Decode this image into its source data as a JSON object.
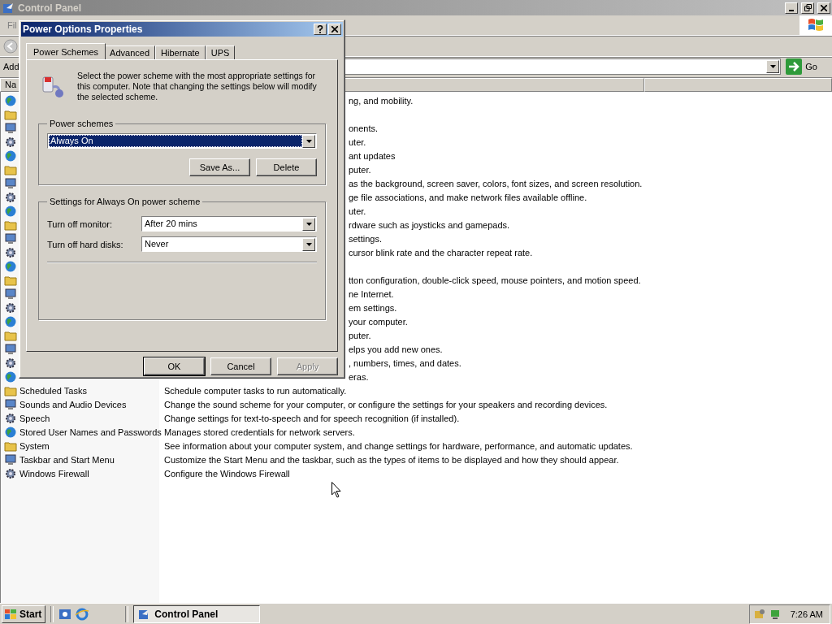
{
  "window": {
    "title": "Control Panel",
    "menu": [
      "Fil"
    ],
    "address_label": "Add",
    "go_button": "Go",
    "columns": [
      "Na"
    ]
  },
  "items": [
    {
      "kind": "partial",
      "description": "ng, and mobility."
    },
    {
      "kind": "blank"
    },
    {
      "kind": "partial",
      "description": "onents."
    },
    {
      "kind": "partial",
      "description": "uter."
    },
    {
      "kind": "partial",
      "description": "ant updates"
    },
    {
      "kind": "partial",
      "description": "puter."
    },
    {
      "kind": "partial",
      "description": "as the background, screen saver, colors, font sizes, and screen resolution."
    },
    {
      "kind": "partial",
      "description": "ge file associations, and make network files available offline."
    },
    {
      "kind": "partial",
      "description": "uter."
    },
    {
      "kind": "partial",
      "description": "rdware such as joysticks and gamepads."
    },
    {
      "kind": "partial",
      "description": "settings."
    },
    {
      "kind": "partial",
      "description": "cursor blink rate and the character repeat rate."
    },
    {
      "kind": "blank"
    },
    {
      "kind": "partial",
      "description": "tton configuration, double-click speed, mouse pointers, and motion speed."
    },
    {
      "kind": "partial",
      "description": "ne Internet."
    },
    {
      "kind": "partial",
      "description": "em settings."
    },
    {
      "kind": "partial",
      "description": "your computer."
    },
    {
      "kind": "partial",
      "description": "puter."
    },
    {
      "kind": "partial",
      "description": "elps you add new ones."
    },
    {
      "kind": "partial",
      "description": ", numbers, times, and dates."
    },
    {
      "kind": "partial",
      "description": "eras."
    },
    {
      "kind": "full",
      "name": "Scheduled Tasks",
      "description": "Schedule computer tasks to run automatically."
    },
    {
      "kind": "full",
      "name": "Sounds and Audio Devices",
      "description": "Change the sound scheme for your computer, or configure the settings for your speakers and recording devices."
    },
    {
      "kind": "full",
      "name": "Speech",
      "description": "Change settings for text-to-speech and for speech recognition (if installed)."
    },
    {
      "kind": "full",
      "name": "Stored User Names and Passwords",
      "description": "Manages stored credentials for network servers."
    },
    {
      "kind": "full",
      "name": "System",
      "description": "See information about your computer system, and change settings for hardware, performance, and automatic updates."
    },
    {
      "kind": "full",
      "name": "Taskbar and Start Menu",
      "description": "Customize the Start Menu and the taskbar, such as the types of items to be displayed and how they should appear."
    },
    {
      "kind": "full",
      "name": "Windows Firewall",
      "description": "Configure the Windows Firewall"
    }
  ],
  "dialog": {
    "title": "Power Options Properties",
    "tabs": [
      {
        "label": "Power Schemes",
        "selected": true
      },
      {
        "label": "Advanced",
        "selected": false
      },
      {
        "label": "Hibernate",
        "selected": false
      },
      {
        "label": "UPS",
        "selected": false
      }
    ],
    "intro": "Select the power scheme with the most appropriate settings for this computer. Note that changing the settings below will modify the selected scheme.",
    "schemes": {
      "label": "Power schemes",
      "value": "Always On",
      "buttons": [
        "Save As...",
        "Delete"
      ]
    },
    "settings": {
      "label": "Settings for Always On power scheme",
      "rows": [
        {
          "label": "Turn off monitor:",
          "value": "After 20 mins"
        },
        {
          "label": "Turn off hard disks:",
          "value": "Never"
        }
      ]
    },
    "buttons": [
      {
        "label": "OK",
        "disabled": false
      },
      {
        "label": "Cancel",
        "disabled": false
      },
      {
        "label": "Apply",
        "disabled": true
      }
    ]
  },
  "taskbar": {
    "start": "Start",
    "tasks": [
      {
        "label": "Control Panel",
        "selected": true
      }
    ],
    "clock": "7:26 AM"
  }
}
